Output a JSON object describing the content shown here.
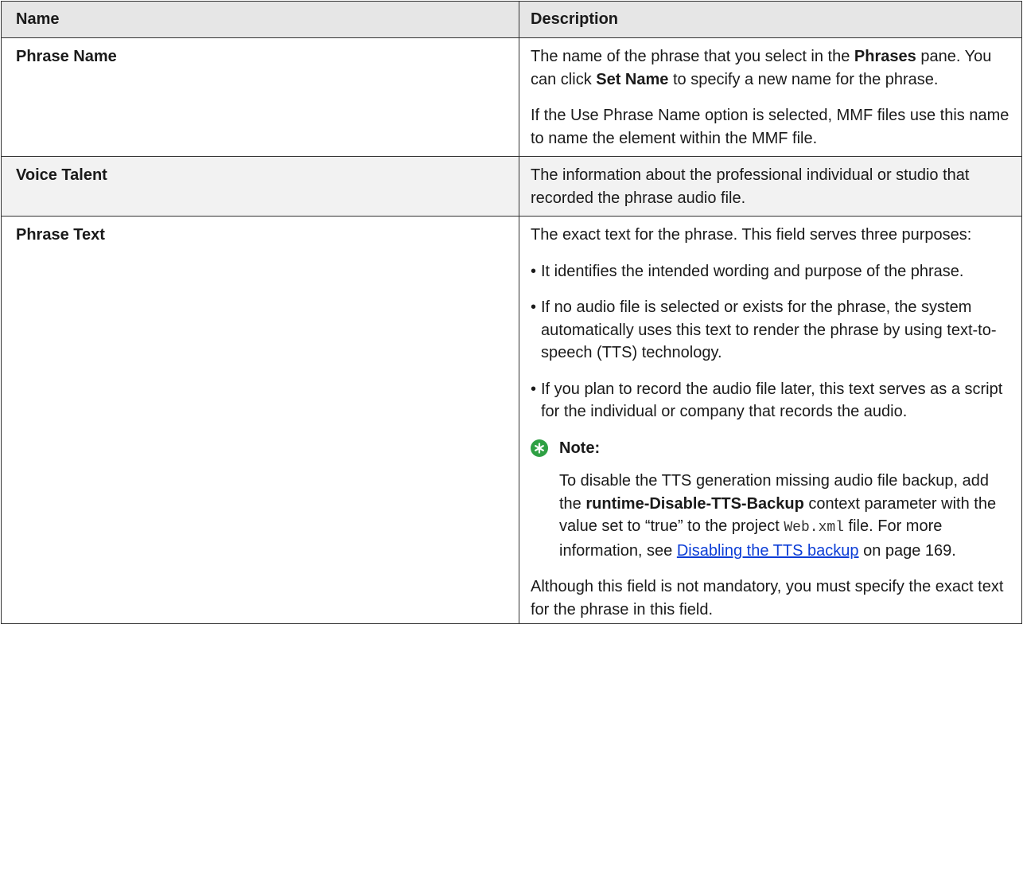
{
  "table": {
    "headers": {
      "name": "Name",
      "description": "Description"
    },
    "rows": [
      {
        "name": "Phrase Name",
        "desc": {
          "p1_a": "The name of the phrase that you select in the ",
          "p1_b": "Phrases",
          "p1_c": " pane. You can click ",
          "p1_d": "Set Name",
          "p1_e": " to specify a new name for the phrase.",
          "p2": "If the Use Phrase Name option is selected, MMF files use this name to name the element within the MMF file."
        }
      },
      {
        "name": "Voice Talent",
        "desc": {
          "p1": "The information about the professional individual or studio that recorded the phrase audio file."
        }
      },
      {
        "name": "Phrase Text",
        "desc": {
          "intro": "The exact text for the phrase. This field serves three purposes:",
          "bullets": [
            "It identifies the intended wording and purpose of the phrase.",
            "If no audio file is selected or exists for the phrase, the system automatically uses this text to render the phrase by using text-to-speech (TTS) technology.",
            "If you plan to record the audio file later, this text serves as a script for the individual or company that records the audio."
          ],
          "bullet_glyph": "•",
          "note": {
            "icon": "star-note-icon",
            "icon_color": "#2ea043",
            "title": "Note:",
            "t1": "To disable the TTS generation missing audio file backup, add the ",
            "t2": "runtime-Disable-TTS-Backup",
            "t3": " context parameter with the value set to “true” to the project ",
            "t4": "Web.xml",
            "t5": " file. For more information, see ",
            "link": "Disabling the TTS backup",
            "t6": " on page 169."
          },
          "outro": "Although this field is not mandatory, you must specify the exact text for the phrase in this field."
        }
      }
    ]
  }
}
